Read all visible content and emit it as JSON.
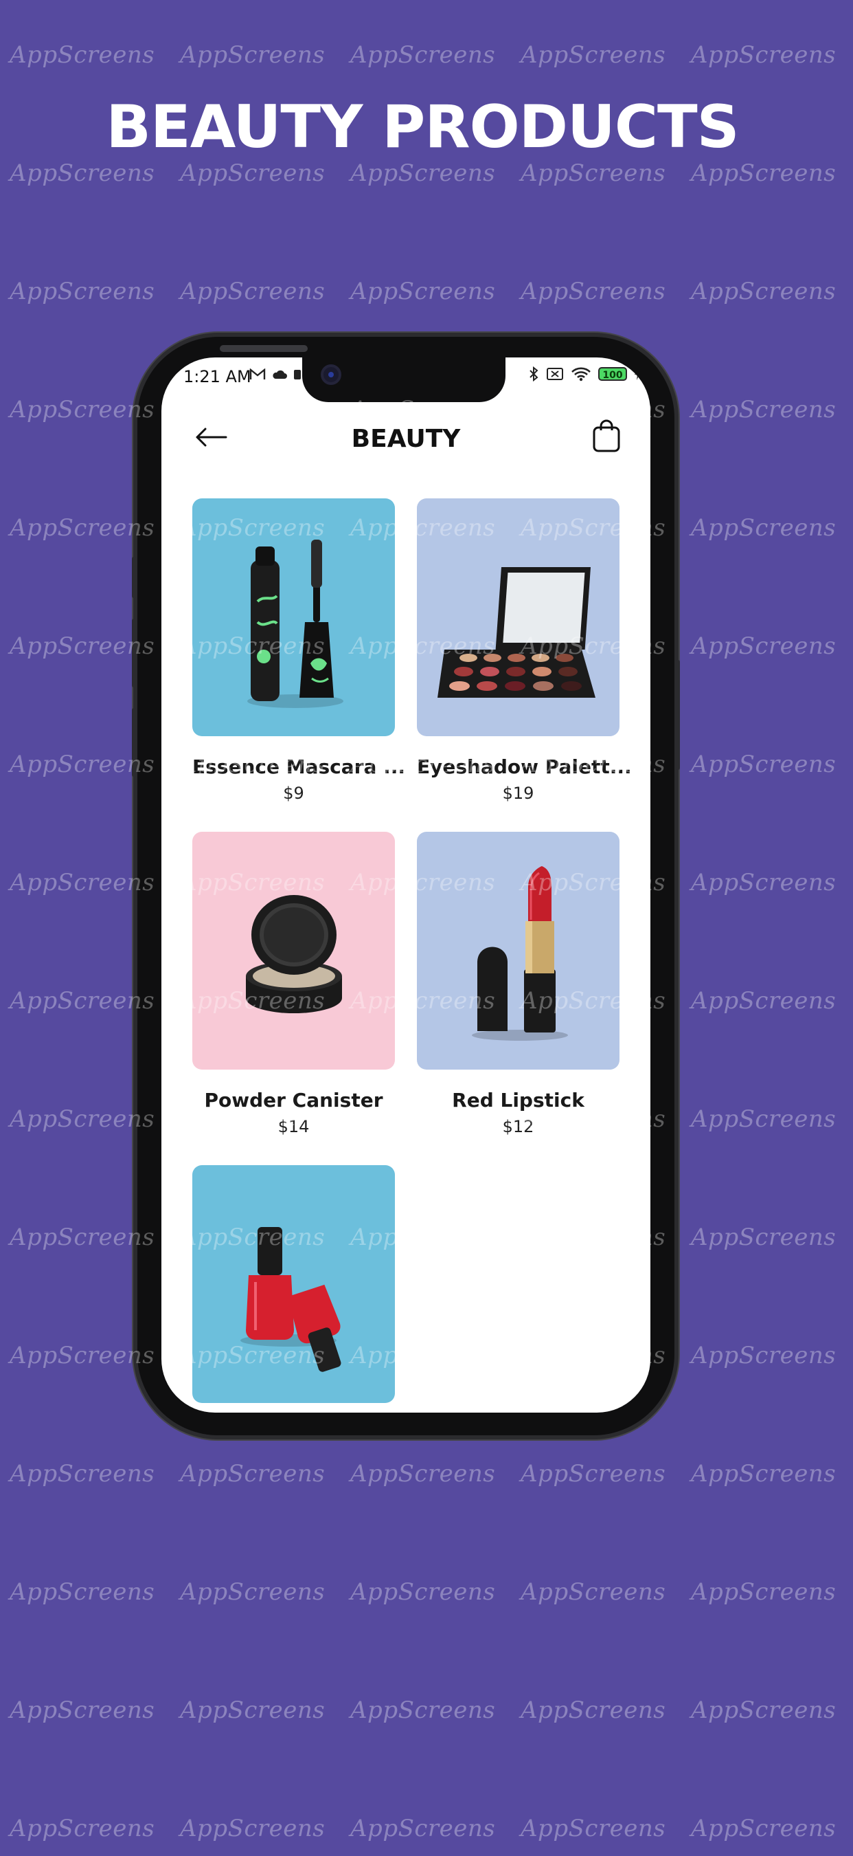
{
  "headline": "BEAUTY PRODUCTS",
  "watermark_text": "AppScreens",
  "colors": {
    "background": "#564a9f",
    "card_blue": "#6cbfdc",
    "card_lavender": "#b4c6e6",
    "card_pink": "#f8c9d6"
  },
  "status_bar": {
    "time": "1:21 AM",
    "battery": "100"
  },
  "nav": {
    "title": "BEAUTY",
    "back_icon": "arrow-left-icon",
    "cart_icon": "shopping-bag-icon"
  },
  "products": [
    {
      "name": "Essence Mascara ...",
      "price": "$9",
      "image": "mascara",
      "bg": "#6cbfdc"
    },
    {
      "name": "Eyeshadow Palett...",
      "price": "$19",
      "image": "eyeshadow-palette",
      "bg": "#b4c6e6"
    },
    {
      "name": "Powder Canister",
      "price": "$14",
      "image": "powder-canister",
      "bg": "#f8c9d6"
    },
    {
      "name": "Red Lipstick",
      "price": "$12",
      "image": "lipstick",
      "bg": "#b4c6e6"
    },
    {
      "name": "",
      "price": "",
      "image": "nail-polish",
      "bg": "#6cbfdc"
    }
  ]
}
